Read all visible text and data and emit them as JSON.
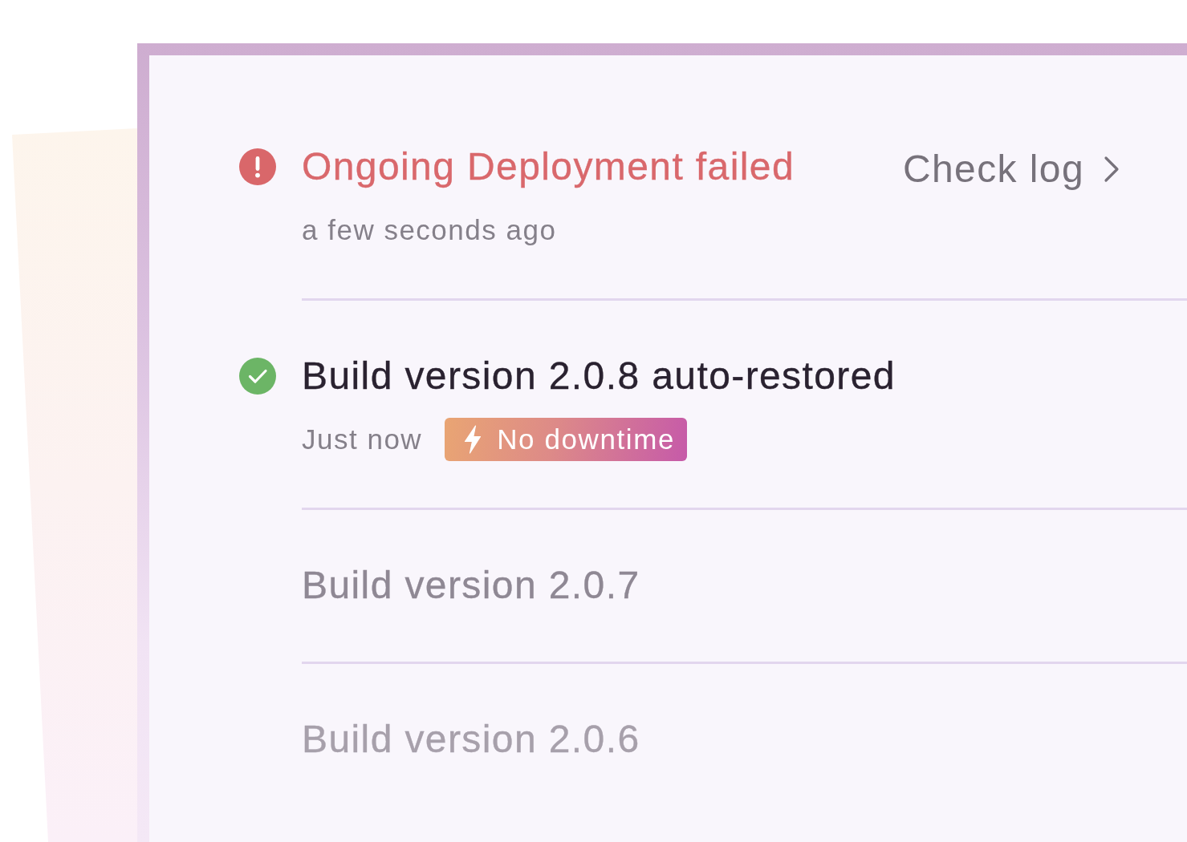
{
  "deployments": [
    {
      "kind": "error",
      "title": "Ongoing Deployment failed",
      "time": "a few seconds ago",
      "action": {
        "label": "Check log"
      }
    },
    {
      "kind": "success",
      "title": "Build version 2.0.8 auto-restored",
      "time": "Just now",
      "badge": {
        "label": "No downtime"
      }
    },
    {
      "kind": "previous",
      "title": "Build version 2.0.7"
    },
    {
      "kind": "previous",
      "title": "Build version 2.0.6"
    }
  ]
}
